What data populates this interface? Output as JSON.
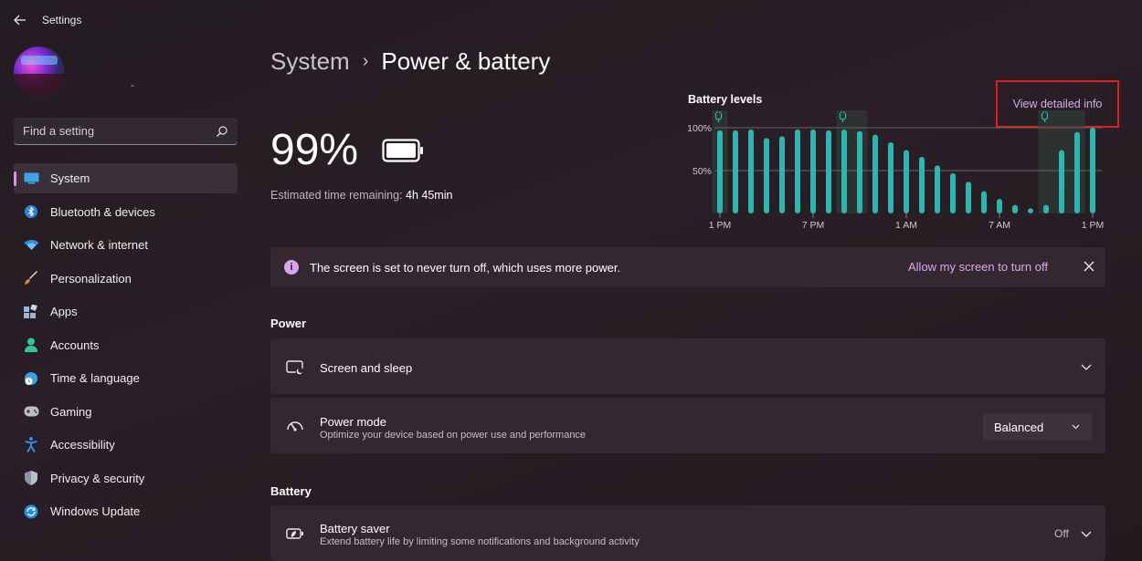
{
  "app": {
    "title": "Settings"
  },
  "sidebar": {
    "search_placeholder": "Find a setting",
    "items": [
      {
        "label": "System",
        "icon": "display-icon",
        "active": true
      },
      {
        "label": "Bluetooth & devices",
        "icon": "bluetooth-icon"
      },
      {
        "label": "Network & internet",
        "icon": "wifi-icon"
      },
      {
        "label": "Personalization",
        "icon": "brush-icon"
      },
      {
        "label": "Apps",
        "icon": "apps-icon"
      },
      {
        "label": "Accounts",
        "icon": "person-icon"
      },
      {
        "label": "Time & language",
        "icon": "globe-clock-icon"
      },
      {
        "label": "Gaming",
        "icon": "gamepad-icon"
      },
      {
        "label": "Accessibility",
        "icon": "accessibility-icon"
      },
      {
        "label": "Privacy & security",
        "icon": "shield-icon"
      },
      {
        "label": "Windows Update",
        "icon": "update-icon"
      }
    ]
  },
  "breadcrumb": {
    "parent": "System",
    "separator": "›",
    "current": "Power & battery"
  },
  "battery": {
    "percent": "99%",
    "est_label": "Estimated time remaining:",
    "est_value": "4h 45min"
  },
  "battery_levels": {
    "title": "Battery levels",
    "detail_link": "View detailed info"
  },
  "chart_data": {
    "type": "bar",
    "title": "Battery levels",
    "y_tick_labels": [
      "100%",
      "50%"
    ],
    "x_tick_labels": [
      "1 PM",
      "7 PM",
      "1 AM",
      "7 AM",
      "1 PM"
    ],
    "ylim": [
      0,
      100
    ],
    "values": [
      97,
      97,
      98,
      88,
      90,
      98,
      98,
      97,
      98,
      96,
      92,
      83,
      74,
      66,
      56,
      47,
      37,
      26,
      17,
      10,
      6,
      10,
      74,
      95,
      100
    ],
    "charging_ranges": [
      [
        0,
        1
      ],
      [
        8,
        10
      ],
      [
        21,
        24
      ]
    ],
    "colors": {
      "bar": "#2ab7b1",
      "charging": "#2d3a36"
    }
  },
  "banner": {
    "message": "The screen is set to never turn off, which uses more power.",
    "link": "Allow my screen to turn off"
  },
  "power": {
    "heading": "Power",
    "screen_sleep": {
      "title": "Screen and sleep"
    },
    "power_mode": {
      "title": "Power mode",
      "desc": "Optimize your device based on power use and performance",
      "value": "Balanced"
    }
  },
  "battery_section": {
    "heading": "Battery",
    "saver": {
      "title": "Battery saver",
      "desc": "Extend battery life by limiting some notifications and background activity",
      "status": "Off"
    }
  }
}
